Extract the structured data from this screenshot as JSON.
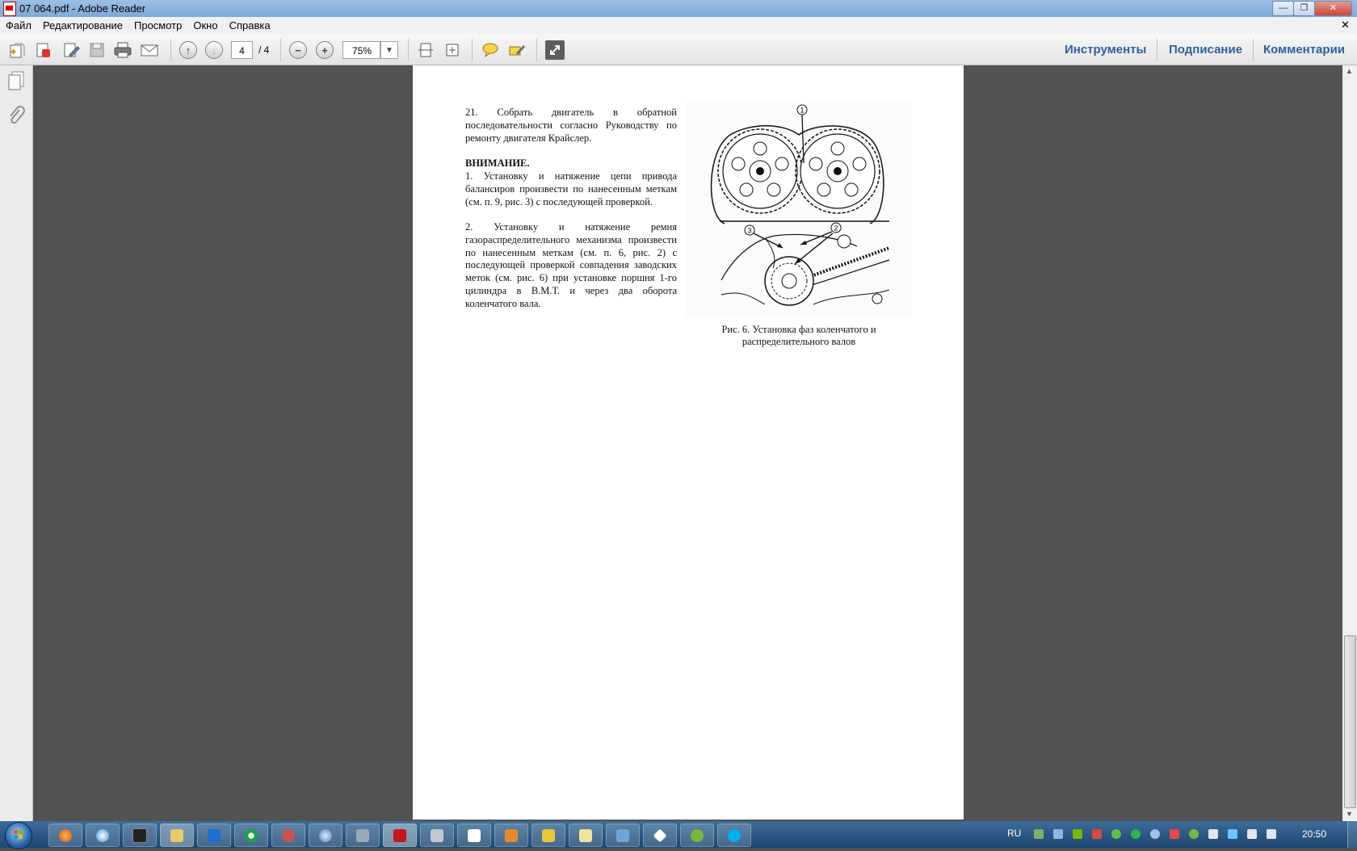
{
  "window": {
    "title": "07 064.pdf - Adobe Reader"
  },
  "menu": [
    "Файл",
    "Редактирование",
    "Просмотр",
    "Окно",
    "Справка"
  ],
  "toolbar": {
    "page_current": "4",
    "page_total": "/ 4",
    "zoom": "75%",
    "right_links": [
      "Инструменты",
      "Подписание",
      "Комментарии"
    ]
  },
  "document": {
    "para_step21": "21. Собрать двигатель в обратной последовательности согласно Руководству по ремонту двигателя Крайслер.",
    "attention_heading": "ВНИМАНИЕ.",
    "para_note1": "1. Установку и натяжение цепи привода балансиров произвести по нанесенным меткам (см. п. 9, рис. 3) с последующей проверкой.",
    "para_note2": "2. Установку и натяжение ремня газораспределительного механизма произвести по нанесенным меткам (см. п. 6, рис. 2) с последующей проверкой совпадения заводских меток (см. рис. 6) при установке поршня 1-го цилиндра в В.М.Т. и через два оборота коленчатого вала.",
    "figure_caption_line1": "Рис. 6. Установка фаз коленчатого и",
    "figure_caption_line2": "распределительного валов",
    "figure_callouts": [
      "1",
      "2",
      "3"
    ]
  },
  "taskbar": {
    "language": "RU",
    "clock": "20:50"
  },
  "icons": [
    "open-icon",
    "create-pdf-icon",
    "edit-icon",
    "save-icon",
    "print-icon",
    "email-icon",
    "page-up-icon",
    "page-down-icon",
    "zoom-out-icon",
    "zoom-in-icon",
    "fit-page-icon",
    "fit-width-icon",
    "comment-icon",
    "highlight-icon",
    "expand-icon",
    "pages-panel-icon",
    "attachments-icon",
    "start-icon"
  ],
  "colors": {
    "link": "#2f5f9d",
    "canvas": "#525252",
    "titlebar": "#8cb3df",
    "close": "#c9463d"
  }
}
